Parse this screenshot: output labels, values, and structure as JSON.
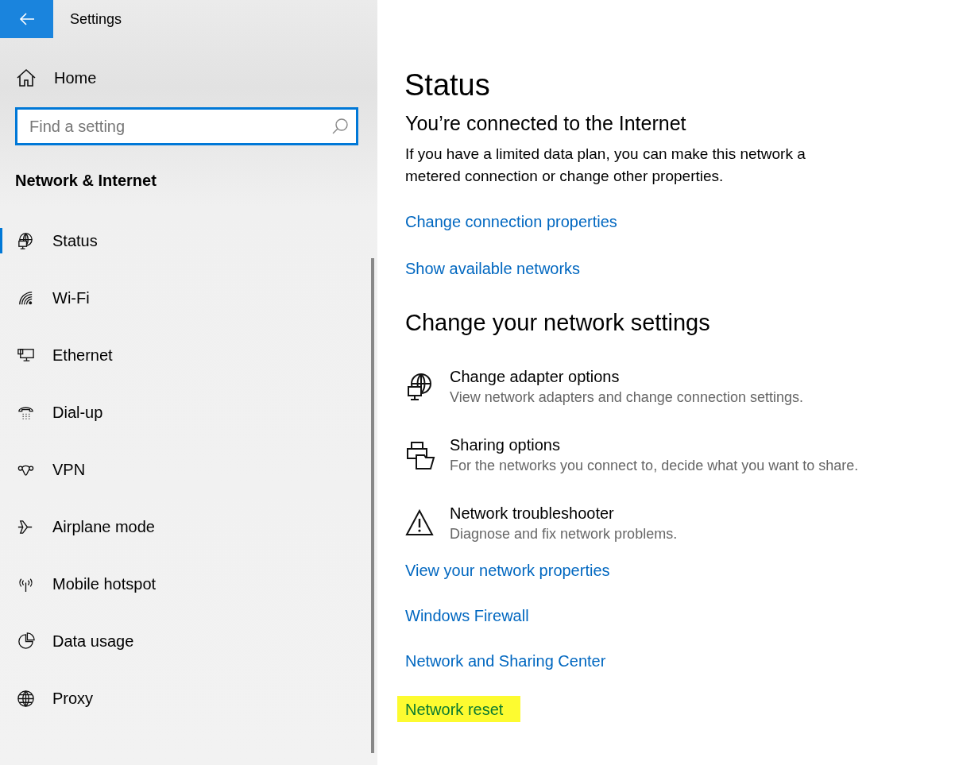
{
  "window": {
    "title": "Settings"
  },
  "sidebar": {
    "home": "Home",
    "search": {
      "placeholder": "Find a setting"
    },
    "section": "Network & Internet",
    "items": [
      {
        "label": "Status",
        "selected": true
      },
      {
        "label": "Wi-Fi",
        "selected": false
      },
      {
        "label": "Ethernet",
        "selected": false
      },
      {
        "label": "Dial-up",
        "selected": false
      },
      {
        "label": "VPN",
        "selected": false
      },
      {
        "label": "Airplane mode",
        "selected": false
      },
      {
        "label": "Mobile hotspot",
        "selected": false
      },
      {
        "label": "Data usage",
        "selected": false
      },
      {
        "label": "Proxy",
        "selected": false
      }
    ]
  },
  "main": {
    "title": "Status",
    "subtitle": "You’re connected to the Internet",
    "description": "If you have a limited data plan, you can make this network a metered connection or change other properties.",
    "links_top": [
      {
        "label": "Change connection properties",
        "highlighted": false
      },
      {
        "label": "Show available networks",
        "highlighted": false
      }
    ],
    "section_heading": "Change your network settings",
    "options": [
      {
        "title": "Change adapter options",
        "description": "View network adapters and change connection settings."
      },
      {
        "title": "Sharing options",
        "description": "For the networks you connect to, decide what you want to share."
      },
      {
        "title": "Network troubleshooter",
        "description": "Diagnose and fix network problems."
      }
    ],
    "links_bottom": [
      {
        "label": "View your network properties",
        "highlighted": false
      },
      {
        "label": "Windows Firewall",
        "highlighted": false
      },
      {
        "label": "Network and Sharing Center",
        "highlighted": false
      },
      {
        "label": "Network reset",
        "highlighted": true
      }
    ]
  }
}
